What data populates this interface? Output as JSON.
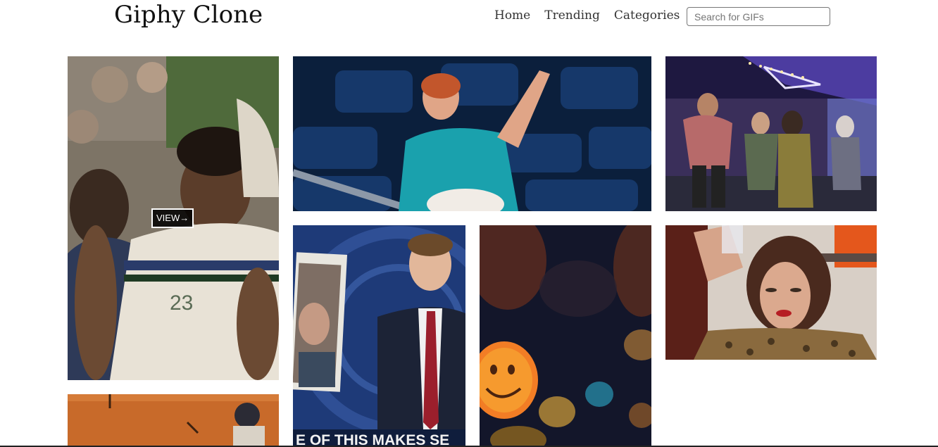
{
  "header": {
    "logo": "Giphy Clone",
    "nav": [
      {
        "label": "Home"
      },
      {
        "label": "Trending"
      },
      {
        "label": "Categories"
      }
    ],
    "search_placeholder": "Search for GIFs"
  },
  "gifs": {
    "view_label": "VIEW→",
    "caption_text": "E OF THIS MAKES SE"
  }
}
